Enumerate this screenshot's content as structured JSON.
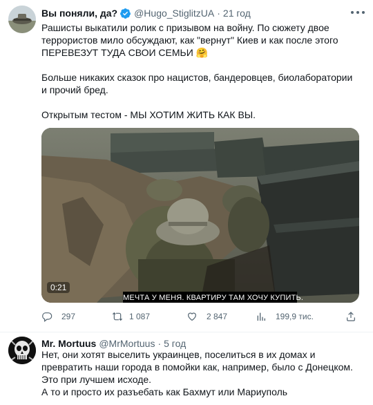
{
  "tweet": {
    "author_name": "Вы поняли, да?",
    "author_handle": "@Hugo_StiglitzUA",
    "time": "21 год",
    "dot": "·",
    "paragraphs": [
      "Рашисты выкатили ролик с призывом на войну. По сюжету двое террористов мило обсуждают, как \"вернут\" Киев и как после этого ПЕРЕВЕЗУТ ТУДА СВОИ СЕМЬИ 🤗",
      "Больше никаких сказок про нацистов, бандеровцев, биолаборатории и прочий бред.",
      "Открытым тестом - МЫ ХОТИМ ЖИТЬ КАК ВЫ."
    ],
    "video": {
      "timestamp": "0:21",
      "subtitle": "МЕЧТА У МЕНЯ. КВАРТИРУ ТАМ ХОЧУ КУПИТЬ."
    },
    "actions": {
      "replies": "297",
      "retweets": "1 087",
      "likes": "2 847",
      "views": "199,9 тис."
    },
    "icons": [
      "verified-badge-icon",
      "more-icon",
      "reply-icon",
      "retweet-icon",
      "like-icon",
      "views-icon",
      "share-icon"
    ],
    "accent_color": "#1d9bf0"
  },
  "reply": {
    "author_name": "Mr. Mortuus",
    "author_handle": "@MrMortuus",
    "time": "5 год",
    "dot": "·",
    "lines": [
      "Нет, они хотят выселить украинцев, поселиться в их домах и превратить наши города в помойки как, например, было с Донецком. Это при лучшем исходе.",
      "А то и просто их разъебать как Бахмут или Мариуполь"
    ]
  }
}
